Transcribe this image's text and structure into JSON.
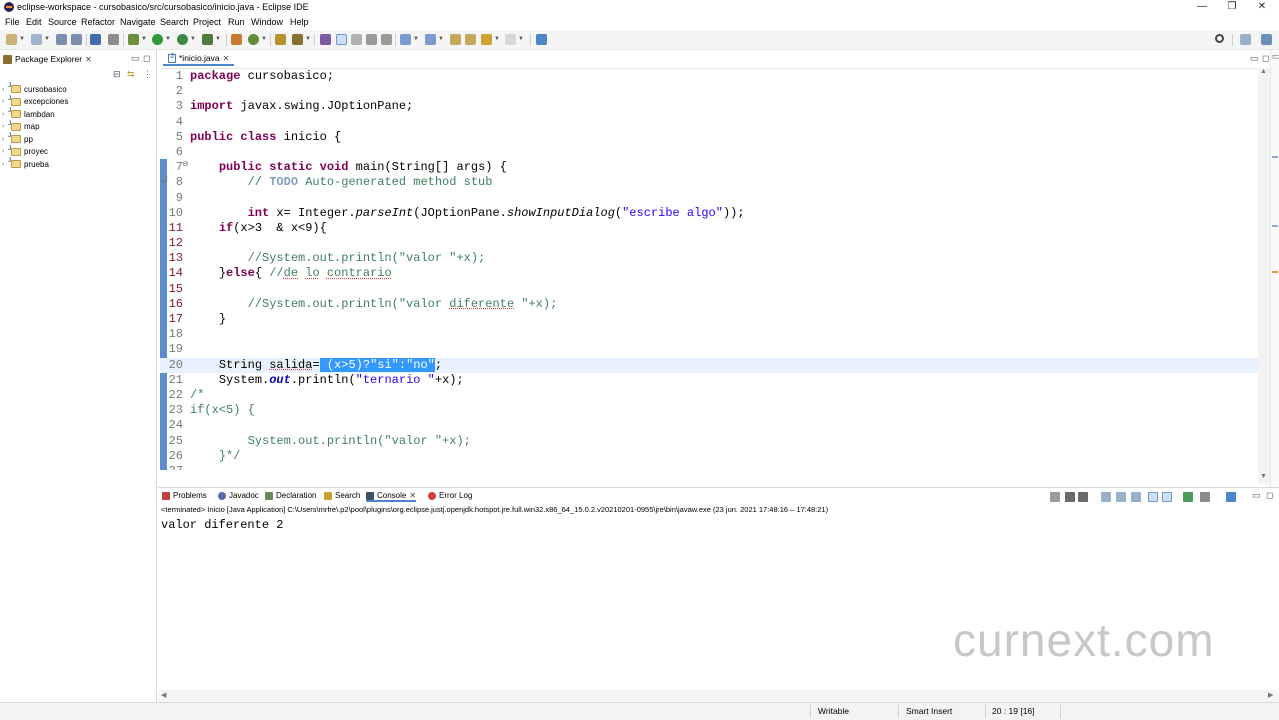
{
  "window": {
    "title": "eclipse-workspace - cursobasico/src/cursobasico/inicio.java - Eclipse IDE",
    "minimize_glyph": "—",
    "restore_glyph": "❐",
    "close_glyph": "✕"
  },
  "menu": [
    "File",
    "Edit",
    "Source",
    "Refactor",
    "Navigate",
    "Search",
    "Project",
    "Run",
    "Window",
    "Help"
  ],
  "package_explorer": {
    "title": "Package Explorer",
    "projects": [
      "cursobasico",
      "excepciones",
      "lambdan",
      "map",
      "pp",
      "proyec",
      "prueba"
    ]
  },
  "editor": {
    "tab_label": "*inicio.java",
    "lines": [
      "1",
      "2",
      "3",
      "4",
      "5",
      "6",
      "7",
      "8",
      "9",
      "10",
      "11",
      "12",
      "13",
      "14",
      "15",
      "16",
      "17",
      "18",
      "19",
      "20",
      "21",
      "22",
      "23",
      "24",
      "25",
      "26",
      "27"
    ],
    "code": {
      "l1_kw": "package",
      "l1_rest": " cursobasico;",
      "l3_kw": "import",
      "l3_rest": " javax.swing.JOptionPane;",
      "l5_kw1": "public",
      "l5_kw2": "class",
      "l5_rest": " inicio {",
      "l7_kw1": "public",
      "l7_kw2": "static",
      "l7_kw3": "void",
      "l7_rest": " main(String[] args) {",
      "l8_cm1": "// ",
      "l8_todo": "TODO",
      "l8_cm2": " Auto-generated method stub",
      "l10_kw": "int",
      "l10_a": " x= Integer.",
      "l10_m1": "parseInt",
      "l10_b": "(JOptionPane.",
      "l10_m2": "showInputDialog",
      "l10_c": "(",
      "l10_str": "\"escribe algo\"",
      "l10_d": "));",
      "l11_kw": "if",
      "l11_rest": "(x>3  & x<9){",
      "l13_cm": "//System.out.println(\"valor \"+x);",
      "l14_a": "}",
      "l14_kw": "else",
      "l14_b": "{ ",
      "l14_cm1": "//",
      "l14_w1": "de",
      "l14_cm2": " ",
      "l14_w2": "lo",
      "l14_cm3": " ",
      "l14_w3": "contrario",
      "l16_cm1": "//System.out.println(\"valor ",
      "l16_w": "diferente",
      "l16_cm2": " \"+x);",
      "l17": "}",
      "l20_a": "String ",
      "l20_var": "salida",
      "l20_b": "=",
      "l20_sel": " (x>5)?\"si\":\"no\"",
      "l20_c": ";",
      "l21_a": "System.",
      "l21_out": "out",
      "l21_b": ".println(",
      "l21_str": "\"ternario \"",
      "l21_c": "+x);",
      "l22": "/*",
      "l23": "if(x<5) {",
      "l25": "System.out.println(\"valor \"+x);",
      "l26": "}*/"
    }
  },
  "console": {
    "tabs": [
      "Problems",
      "Javadoc",
      "Declaration",
      "Search",
      "Console",
      "Error Log"
    ],
    "info": "<terminated> Inicio [Java Application] C:\\Users\\mrfre\\.p2\\pool\\plugins\\org.eclipse.justj.openjdk.hotspot.jre.full.win32.x86_64_15.0.2.v20210201-0955\\jre\\bin\\javaw.exe  (23 jun. 2021 17:48:16 – 17:48:21)",
    "output": "valor diferente 2"
  },
  "watermark": "curnext.com",
  "status": {
    "writable": "Writable",
    "insert_mode": "Smart Insert",
    "position": "20 : 19 [16]"
  }
}
